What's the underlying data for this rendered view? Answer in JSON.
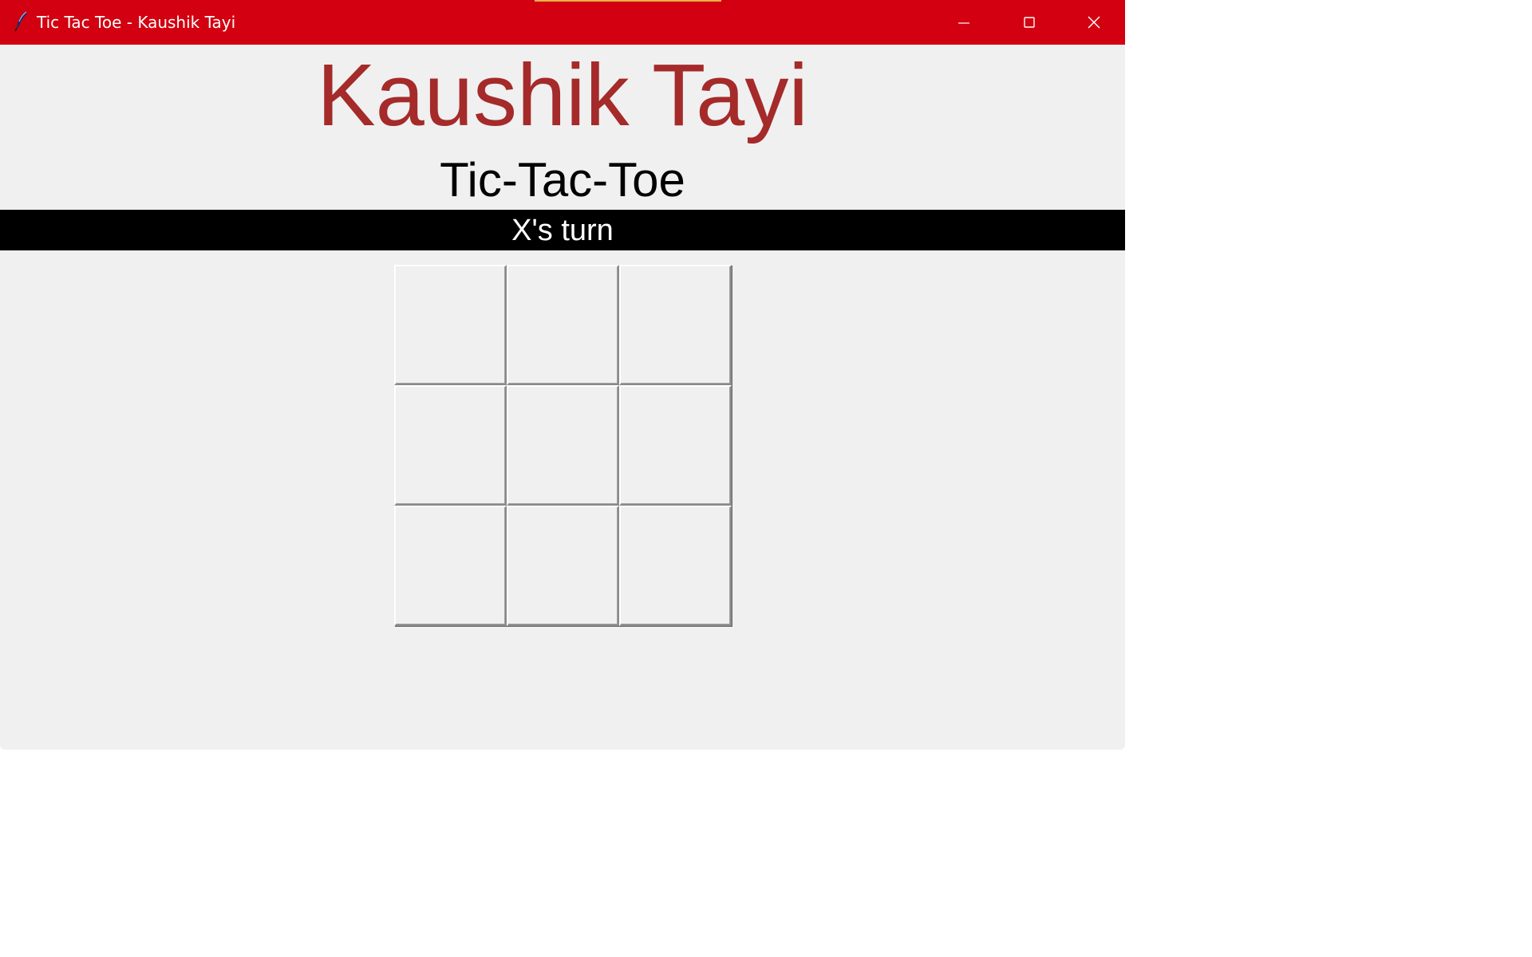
{
  "window": {
    "title": "Tic Tac Toe - Kaushik Tayi",
    "icon": "feather-icon",
    "titlebar_color": "#d20010"
  },
  "controls": {
    "minimize_icon": "minimize-icon",
    "maximize_icon": "maximize-icon",
    "close_icon": "close-icon"
  },
  "header": {
    "name": "Kaushik Tayi",
    "name_color": "#a52a2a",
    "game_title": "Tic-Tac-Toe"
  },
  "status": {
    "text": "X's turn",
    "background": "#000000",
    "color": "#ffffff"
  },
  "board": {
    "rows": 3,
    "cols": 3,
    "cells": [
      "",
      "",
      "",
      "",
      "",
      "",
      "",
      "",
      ""
    ]
  }
}
